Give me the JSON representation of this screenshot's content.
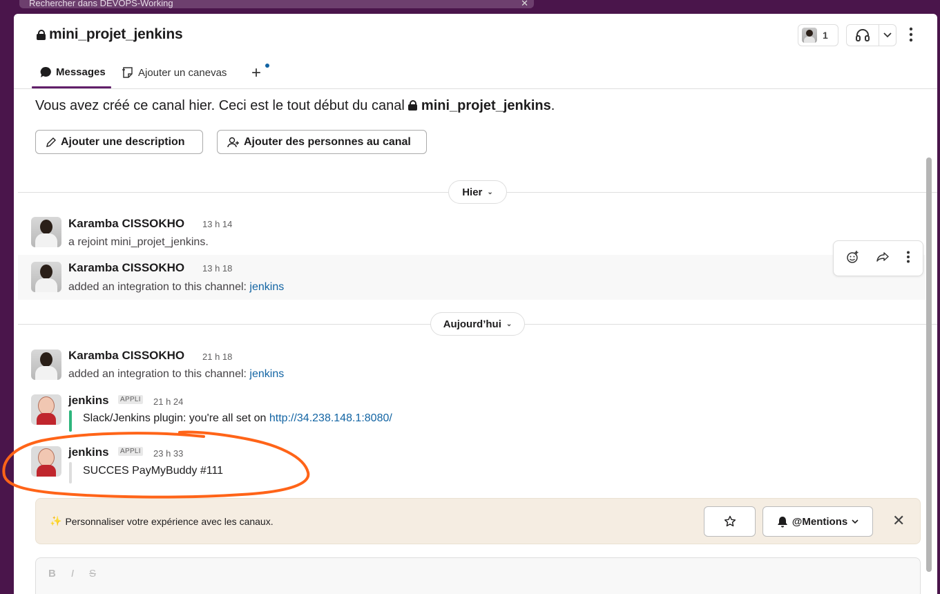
{
  "search": {
    "placeholder": "Rechercher dans DEVOPS-Working"
  },
  "channel": {
    "name": "mini_projet_jenkins",
    "member_count": "1"
  },
  "tabs": {
    "messages": "Messages",
    "canvas": "Ajouter un canevas"
  },
  "intro": {
    "text_before": "Vous avez créé ce canal hier. Ceci est le tout début du canal ",
    "channel": "mini_projet_jenkins",
    "text_after": "."
  },
  "actions": {
    "add_description": "Ajouter une description",
    "add_people": "Ajouter des personnes au canal"
  },
  "dividers": {
    "yesterday": "Hier",
    "today": "Aujourd’hui"
  },
  "messages": [
    {
      "author": "Karamba CISSOKHO",
      "time": "13 h 14",
      "text": "a rejoint mini_projet_jenkins."
    },
    {
      "author": "Karamba CISSOKHO",
      "time": "13 h 18",
      "text": "added an integration to this channel: ",
      "link": "jenkins"
    },
    {
      "author": "Karamba CISSOKHO",
      "time": "21 h 18",
      "text": "added an integration to this channel: ",
      "link": "jenkins"
    },
    {
      "author": "jenkins",
      "badge": "APPLI",
      "time": "21 h 24",
      "text": "Slack/Jenkins plugin: you're all set on ",
      "link": "http://34.238.148.1:8080/",
      "bar_color": "#2eb67d"
    },
    {
      "author": "jenkins",
      "badge": "APPLI",
      "time": "23 h 33",
      "text": "SUCCES PayMyBuddy #111",
      "bar_color": "#dddddd"
    }
  ],
  "banner": {
    "emoji": "✨",
    "text": "Personnaliser votre expérience avec les canaux.",
    "mentions": "@Mentions"
  },
  "composer": {
    "tools": [
      "B",
      "I",
      "S"
    ]
  },
  "colors": {
    "sidebar": "#4a154b",
    "accent": "#611f69",
    "link": "#1264a3",
    "annotation": "#ff6418"
  },
  "icons": [
    "lock-icon",
    "headphones-icon",
    "kebab-icon",
    "chat-bubble-icon",
    "canvas-icon",
    "plus-icon",
    "pencil-icon",
    "add-person-icon",
    "emoji-add-icon",
    "forward-icon",
    "star-icon",
    "bell-icon",
    "close-icon"
  ]
}
